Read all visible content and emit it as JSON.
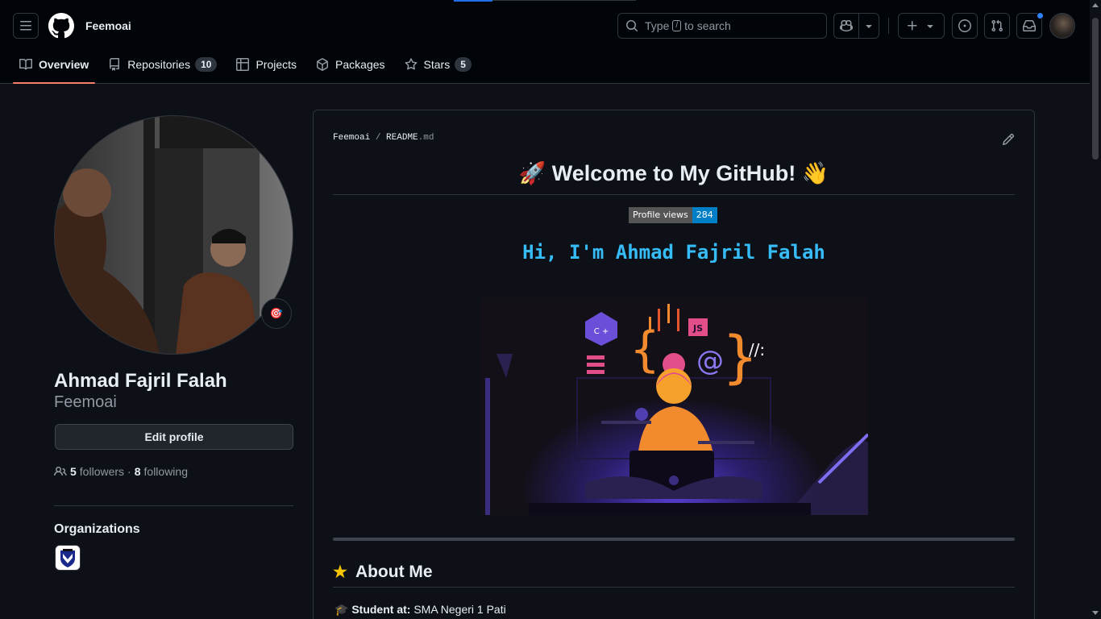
{
  "header": {
    "username": "Feemoai",
    "search": {
      "prefix": "Type",
      "key": "/",
      "suffix": "to search"
    },
    "tabs": [
      {
        "label": "Overview",
        "icon": "book-icon",
        "active": true
      },
      {
        "label": "Repositories",
        "icon": "repo-icon",
        "count": "10"
      },
      {
        "label": "Projects",
        "icon": "table-icon"
      },
      {
        "label": "Packages",
        "icon": "package-icon"
      },
      {
        "label": "Stars",
        "icon": "star-icon",
        "count": "5"
      }
    ],
    "icons": [
      "hamburger-icon",
      "github-logo",
      "search-icon",
      "copilot-icon",
      "chevron-down-icon",
      "plus-icon",
      "issue-icon",
      "pull-request-icon",
      "inbox-icon"
    ],
    "accent": "#f78166",
    "notification_color": "#2f81f7"
  },
  "profile": {
    "status_emoji": "🎯",
    "full_name": "Ahmad Fajril Falah",
    "login": "Feemoai",
    "edit_label": "Edit profile",
    "followers_count": "5",
    "followers_label": "followers",
    "dot": "·",
    "following_count": "8",
    "following_label": "following",
    "organizations_title": "Organizations"
  },
  "readme": {
    "path_user": "Feemoai",
    "path_sep": "/",
    "path_file": "README",
    "path_ext": ".md",
    "title": "🚀 Welcome to My GitHub! 👋",
    "badge_label": "Profile views",
    "badge_value": "284",
    "typing_text": "Hi, I'm Ahmad Fajril Falah",
    "typing_color": "#36bcf7",
    "illustration_labels": {
      "cpp": "C +",
      "js": "JS",
      "at": "@",
      "slashes": "//:"
    },
    "about_title": "About Me",
    "about_icon": "★",
    "about_lines": [
      {
        "emoji": "🎓",
        "label": "Student at:",
        "value": "SMA Negeri 1 Pati"
      }
    ]
  }
}
